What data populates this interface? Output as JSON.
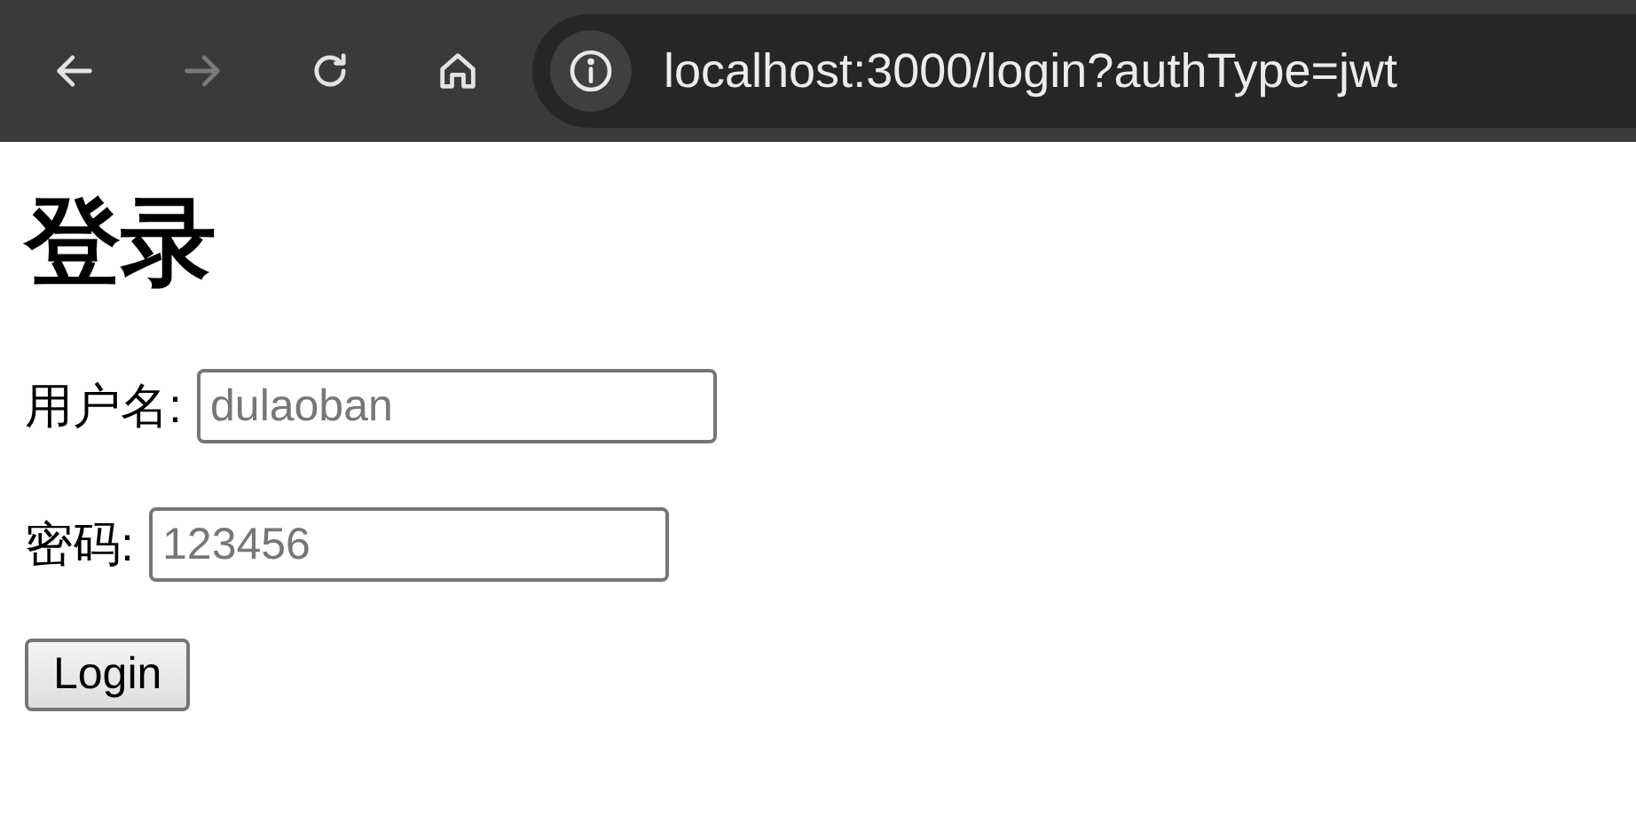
{
  "toolbar": {
    "buttons": [
      {
        "kind": "back",
        "disabled": false
      },
      {
        "kind": "forward",
        "disabled": true
      },
      {
        "kind": "reload",
        "disabled": false
      },
      {
        "kind": "home",
        "disabled": false
      }
    ],
    "address": "localhost:3000/login?authType=jwt"
  },
  "page": {
    "heading": "登录",
    "fields": [
      {
        "label": "用户名:",
        "placeholder": "dulaoban"
      },
      {
        "label": "密码:",
        "placeholder": "123456"
      }
    ],
    "submit": "Login"
  }
}
